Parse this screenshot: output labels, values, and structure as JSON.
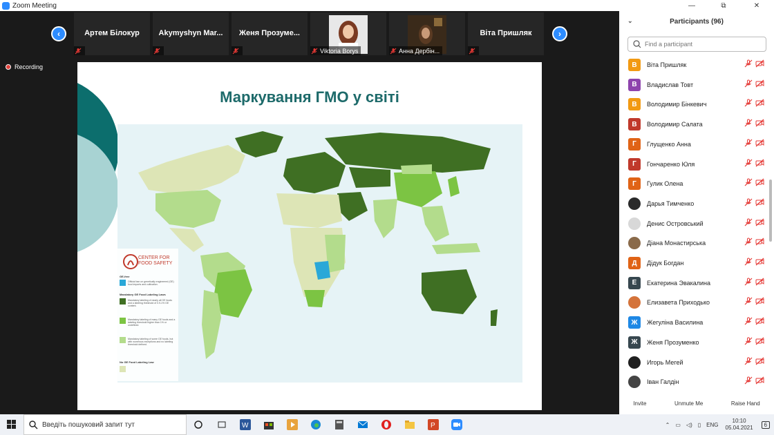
{
  "window": {
    "title": "Zoom Meeting",
    "controls": {
      "minimize": "—",
      "restore": "⧉",
      "close": "✕"
    }
  },
  "video_strip": {
    "prev_arrow": "‹",
    "next_arrow": "›",
    "tiles": [
      {
        "name": "Артем Білокур",
        "muted": true,
        "has_photo": false
      },
      {
        "name": "Akymyshyn Mar...",
        "muted": true,
        "has_photo": false
      },
      {
        "name": "Женя Прозуме...",
        "muted": true,
        "has_photo": false
      },
      {
        "name": "Viktoria Borys",
        "muted": true,
        "has_photo": true
      },
      {
        "name": "Анна Дербін...",
        "muted": true,
        "has_photo": true
      },
      {
        "name": "Віта Пришляк",
        "muted": true,
        "has_photo": false
      }
    ]
  },
  "recording": {
    "label": "Recording"
  },
  "slide": {
    "title": "Маркування ГМО у світі",
    "legend": {
      "org": "CENTER FOR FOOD SAFETY",
      "ge_free_header": "GE-free",
      "ge_free_text": "Official ban on genetically engineered (GE) food imports and cultivation.",
      "mandatory_header": "Mandatory GE Food Labeling Laws",
      "mand1_text": "Mandatory labeling of nearly all GE foods and a labeling threshold of 0.9-1% GE content.",
      "mand2_text": "Mandatory labeling of many GE foods and a labeling threshold higher than 1% or undefined.",
      "mand3_text": "Mandatory labeling of some GE foods, but with numerous exceptions and no labeling threshold defined.",
      "none_header": "No GE Food Labeling Law"
    },
    "colors": {
      "ge_free": "#2aa8d8",
      "mand1": "#3f6f23",
      "mand2": "#7cc443",
      "mand3": "#b3dc8c",
      "none": "#dde5b6"
    }
  },
  "participants": {
    "header": "Participants (96)",
    "search_placeholder": "Find a participant",
    "list": [
      {
        "name": "Віта Пришляк",
        "initial": "В",
        "color": "#f29a12"
      },
      {
        "name": "Владислав Товт",
        "initial": "В",
        "color": "#8e44ad"
      },
      {
        "name": "Володимир Бінкевич",
        "initial": "В",
        "color": "#f29a12"
      },
      {
        "name": "Володимир Салата",
        "initial": "В",
        "color": "#c0392b"
      },
      {
        "name": "Глущенко Анна",
        "initial": "Г",
        "color": "#e06316"
      },
      {
        "name": "Гончаренко Юля",
        "initial": "Г",
        "color": "#c0392b"
      },
      {
        "name": "Гулик Олена",
        "initial": "Г",
        "color": "#e06316"
      },
      {
        "name": "Дарья Тимченко",
        "initial": "",
        "color": "#2a2a2a"
      },
      {
        "name": "Денис Островський",
        "initial": "",
        "color": "#d8d8d8"
      },
      {
        "name": "Діана Монастирська",
        "initial": "",
        "color": "#8a6a4a"
      },
      {
        "name": "Дідук Богдан",
        "initial": "Д",
        "color": "#e06316"
      },
      {
        "name": "Екатерина Эвакалина",
        "initial": "Е",
        "color": "#37474f"
      },
      {
        "name": "Елизавета Приходько",
        "initial": "",
        "color": "#d4733a"
      },
      {
        "name": "Жегуліна Василина",
        "initial": "Ж",
        "color": "#1e88e5"
      },
      {
        "name": "Женя Прозуменко",
        "initial": "Ж",
        "color": "#37474f"
      },
      {
        "name": "Игорь Мегей",
        "initial": "",
        "color": "#1f1f1f"
      },
      {
        "name": "Іван Галдін",
        "initial": "",
        "color": "#444444"
      }
    ],
    "footer": {
      "invite": "Invite",
      "unmute": "Unmute Me",
      "raise_hand": "Raise Hand"
    }
  },
  "taskbar": {
    "search_placeholder": "Введіть пошуковий запит тут",
    "language": "ENG",
    "time": "10:10",
    "date": "05.04.2021",
    "notifications": "6"
  }
}
